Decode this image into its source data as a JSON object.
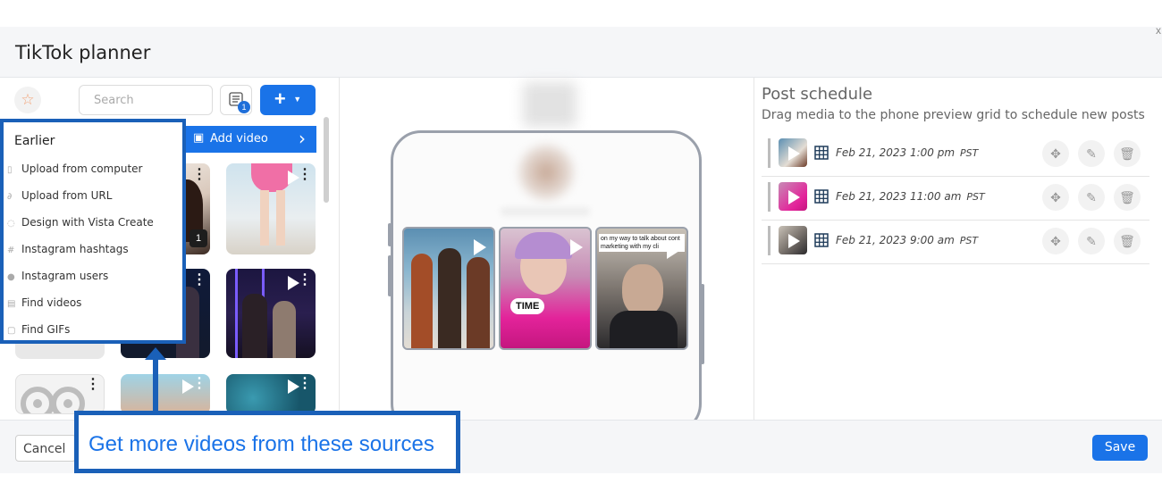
{
  "modal": {
    "title": "TikTok planner",
    "close_glyph": "x"
  },
  "toolbar": {
    "search_placeholder": "Search",
    "filter_badge": "1",
    "add_button_label": "+",
    "add_video_label": "Add video"
  },
  "dropdown": {
    "title": "Earlier",
    "items": [
      {
        "label": "Upload from computer",
        "icon": "file-icon"
      },
      {
        "label": "Upload from URL",
        "icon": "link-icon"
      },
      {
        "label": "Design with Vista Create",
        "icon": "palette-icon"
      },
      {
        "label": "Instagram hashtags",
        "icon": "hashtag-icon"
      },
      {
        "label": "Instagram users",
        "icon": "user-icon"
      },
      {
        "label": "Find videos",
        "icon": "video-icon"
      },
      {
        "label": "Find GIFs",
        "icon": "gif-icon"
      }
    ]
  },
  "media_grid": {
    "badge_value": "1"
  },
  "callout": {
    "text": "Get more videos from these sources"
  },
  "phone_preview": {
    "time_label": "TIME",
    "caption": "on my way to talk about cont marketing with my cli"
  },
  "schedule": {
    "title": "Post schedule",
    "subtitle": "Drag media to the phone preview grid to schedule new posts",
    "rows": [
      {
        "date": "Feb 21, 2023 1:00 pm",
        "tz": "PST"
      },
      {
        "date": "Feb 21, 2023 11:00 am",
        "tz": "PST"
      },
      {
        "date": "Feb 21, 2023 9:00 am",
        "tz": "PST"
      }
    ]
  },
  "footer": {
    "cancel_label": "Cancel",
    "save_label": "Save"
  },
  "colors": {
    "accent": "#1a73e8",
    "callout_border": "#1a60b8"
  }
}
